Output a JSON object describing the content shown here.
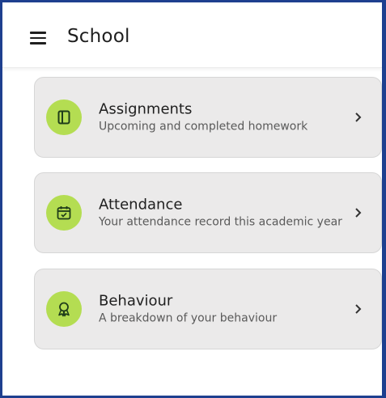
{
  "header": {
    "title": "School",
    "menu_icon": "hamburger-menu-icon"
  },
  "colors": {
    "icon_badge": "#b4dd52",
    "card_background": "#ebeaea",
    "frame_border": "#1e3f8f"
  },
  "cards": [
    {
      "title": "Assignments",
      "subtitle": "Upcoming and completed homework",
      "icon": "notebook-icon"
    },
    {
      "title": "Attendance",
      "subtitle": "Your attendance record this academic year",
      "icon": "calendar-check-icon"
    },
    {
      "title": "Behaviour",
      "subtitle": "A breakdown of your behaviour",
      "icon": "award-ribbon-icon"
    }
  ]
}
